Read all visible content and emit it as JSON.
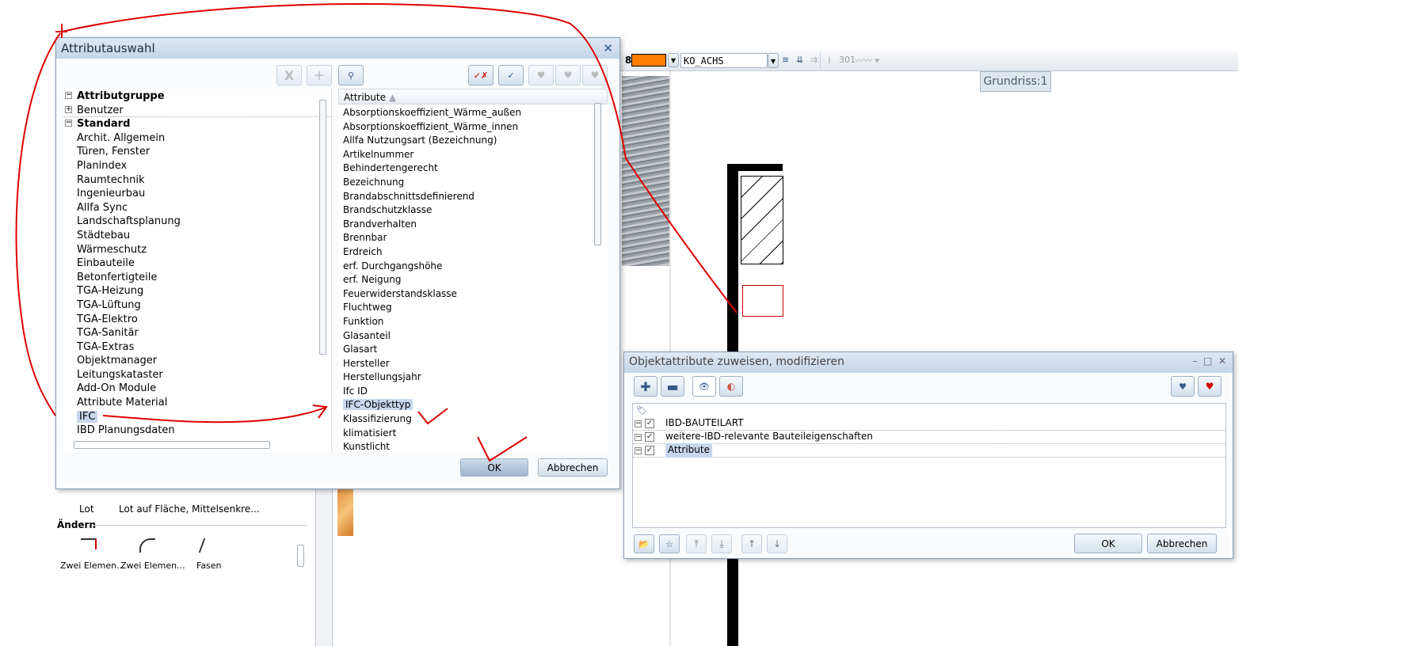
{
  "toolbar": {
    "layer_number": "8",
    "pen_color": "#ff8000",
    "layer_name": "KO_ACHS",
    "line_number": "301"
  },
  "viewport": {
    "label": "Grundriss:1"
  },
  "bottom_panel": {
    "items": [
      "Lot",
      "Lot auf Fläche, Mittelsenkre..."
    ],
    "section": "Ändern",
    "items2": [
      "Zwei Elemen...",
      "Zwei Elemen...",
      "Fasen"
    ]
  },
  "attr_dialog": {
    "title": "Attributauswahl",
    "tree": {
      "root": "Attributgruppe",
      "groups": [
        "Benutzer",
        "Standard"
      ],
      "items": [
        "Archit. Allgemein",
        "Türen, Fenster",
        "Planindex",
        "Raumtechnik",
        "Ingenieurbau",
        "Allfa Sync",
        "Landschaftsplanung",
        "Städtebau",
        "Wärmeschutz",
        "Einbauteile",
        "Betonfertigteile",
        "TGA-Heizung",
        "TGA-Lüftung",
        "TGA-Elektro",
        "TGA-Sanitär",
        "TGA-Extras",
        "Objektmanager",
        "Leitungskataster",
        "Add-On Module",
        "Attribute Material",
        "IFC",
        "IBD Planungsdaten"
      ],
      "selected": "IFC"
    },
    "list": {
      "header": "Attribute",
      "items": [
        "Absorptionskoeffizient_Wärme_außen",
        "Absorptionskoeffizient_Wärme_innen",
        "Allfa Nutzungsart (Bezeichnung)",
        "Artikelnummer",
        "Behindertengerecht",
        "Bezeichnung",
        "Brandabschnittsdefinierend",
        "Brandschutzklasse",
        "Brandverhalten",
        "Brennbar",
        "Erdreich",
        "erf. Durchgangshöhe",
        "erf. Neigung",
        "Feuerwiderstandsklasse",
        "Fluchtweg",
        "Funktion",
        "Glasanteil",
        "Glasart",
        "Hersteller",
        "Herstellungsjahr",
        "Ifc ID",
        "IFC-Objekttyp",
        "Klassifizierung",
        "klimatisiert",
        "Kunstlicht"
      ],
      "selected": "IFC-Objekttyp"
    },
    "ok": "OK",
    "cancel": "Abbrechen"
  },
  "obj_dialog": {
    "title": "Objektattribute zuweisen, modifizieren",
    "tree": [
      "IBD-BAUTEILART",
      "weitere-IBD-relevante Bauteileigenschaften",
      "Attribute"
    ],
    "selected": "Attribute",
    "ok": "OK",
    "cancel": "Abbrechen"
  },
  "annotation_color": "#e00000"
}
